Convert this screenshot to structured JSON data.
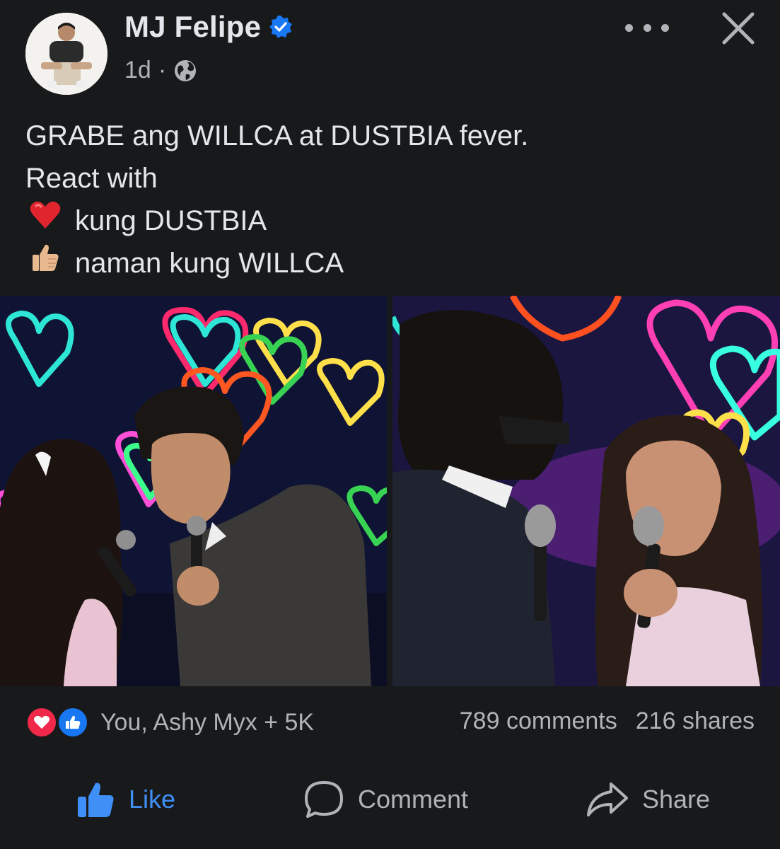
{
  "author": {
    "name": "MJ Felipe",
    "verified": true,
    "time": "1d",
    "separator": "·",
    "audience_icon": "globe-icon"
  },
  "post": {
    "lines": [
      "GRABE ang WILLCA at DUSTBIA fever.",
      "React with",
      "kung DUSTBIA",
      "naman kung WILLCA"
    ],
    "emojis": [
      "❤️",
      "👍🏼"
    ]
  },
  "reactions": {
    "summary": "You, Ashy Myx + 5K",
    "icons": [
      "love-icon",
      "like-icon"
    ]
  },
  "counts": {
    "comments": "789 comments",
    "shares": "216 shares"
  },
  "actions": {
    "like": "Like",
    "comment": "Comment",
    "share": "Share"
  },
  "colors": {
    "background": "#18191a",
    "text": "#e4e6eb",
    "muted": "#b0b3b8",
    "accent": "#1877f2",
    "love": "#f0284a"
  }
}
